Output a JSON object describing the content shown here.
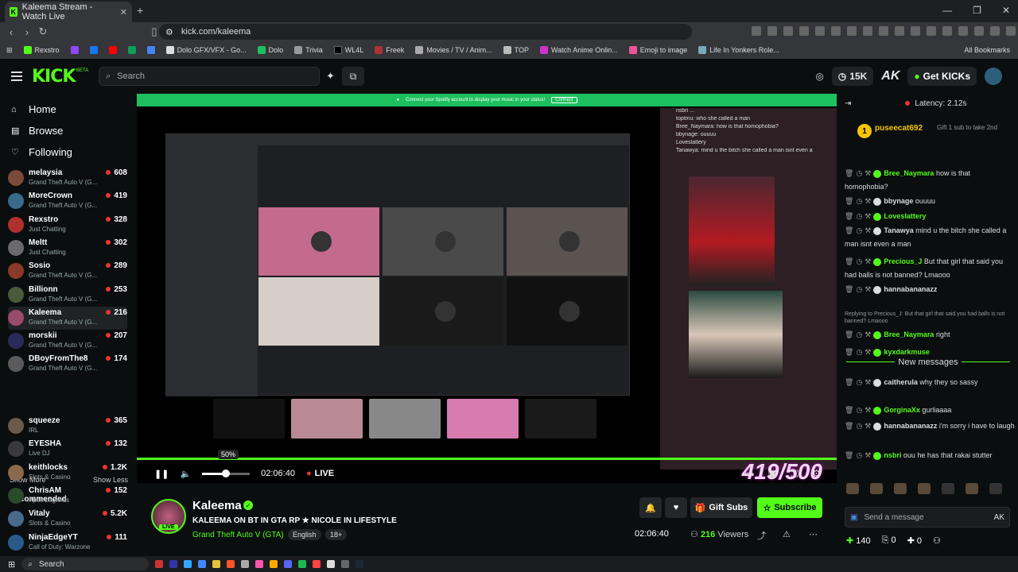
{
  "browser": {
    "tab_title": "Kaleema Stream - Watch Live",
    "url": "kick.com/kaleema",
    "bookmarks": [
      "Rexstro",
      "Dolo GFX/VFX - Go...",
      "Dolo",
      "Trivia",
      "WL4L",
      "Freek",
      "Movies / TV / Anim...",
      "TOP",
      "Watch Anime Onlin...",
      "Emoji to image",
      "Life In Yonkers Role..."
    ],
    "all_bookmarks": "All Bookmarks"
  },
  "header": {
    "logo": "KICK",
    "beta": "BETA",
    "search_placeholder": "Search",
    "kicks": "15K",
    "ak": "AK",
    "get_kicks": "Get KICKs"
  },
  "sidebar": {
    "nav": [
      {
        "label": "Home",
        "icon": "home-icon"
      },
      {
        "label": "Browse",
        "icon": "browse-icon"
      },
      {
        "label": "Following",
        "icon": "heart-icon"
      }
    ],
    "following": [
      {
        "name": "melaysia",
        "game": "Grand Theft Auto V (G...",
        "viewers": "608",
        "color": "#7a4a3a"
      },
      {
        "name": "MoreCrown",
        "game": "Grand Theft Auto V (G...",
        "viewers": "419",
        "color": "#3a6a8a"
      },
      {
        "name": "Rexstro",
        "game": "Just Chatting",
        "viewers": "328",
        "color": "#b03030"
      },
      {
        "name": "Meltt",
        "game": "Just Chatting",
        "viewers": "302",
        "color": "#6a6a6a"
      },
      {
        "name": "Sosio",
        "game": "Grand Theft Auto V (G...",
        "viewers": "289",
        "color": "#8a3a2a"
      },
      {
        "name": "Billionn",
        "game": "Grand Theft Auto V (G...",
        "viewers": "253",
        "color": "#4a5a3a"
      },
      {
        "name": "Kaleema",
        "game": "Grand Theft Auto V (G...",
        "viewers": "216",
        "color": "#9a4a6a"
      },
      {
        "name": "morskii",
        "game": "Grand Theft Auto V (G...",
        "viewers": "207",
        "color": "#2a2a5a"
      },
      {
        "name": "DBoyFromThe8",
        "game": "Grand Theft Auto V (G...",
        "viewers": "174",
        "color": "#5a5a5a"
      }
    ],
    "show_more": "Show More",
    "show_less": "Show Less",
    "recommended_title": "Recommended",
    "recommended": [
      {
        "name": "squeeze",
        "game": "IRL",
        "viewers": "365",
        "color": "#6a5a4a"
      },
      {
        "name": "EYESHA",
        "game": "Live DJ",
        "viewers": "132",
        "color": "#3a3a3a"
      },
      {
        "name": "keithlocks",
        "game": "Slots & Casino",
        "viewers": "1.2K",
        "color": "#8a6a4a"
      },
      {
        "name": "ChrisAM",
        "game": "Apex Legends",
        "viewers": "152",
        "color": "#2a4a2a"
      },
      {
        "name": "Vitaly",
        "game": "Slots & Casino",
        "viewers": "5.2K",
        "color": "#4a6a8a"
      },
      {
        "name": "NinjaEdgeYT",
        "game": "Call of Duty: Warzone",
        "viewers": "111",
        "color": "#2a5a8a"
      }
    ]
  },
  "video": {
    "spotify_banner": "Connect your Spotify account to display your music in your status!",
    "spotify_button": "Connect",
    "overlay_count": "419/500",
    "volume_tooltip": "50%",
    "volume": 0.5,
    "time": "02:06:40",
    "live": "LIVE"
  },
  "stream": {
    "name": "Kaleema",
    "title": "KALEEMA ON BT IN GTA RP ★ NICOLE IN LIFESTYLE",
    "game": "Grand Theft Auto V (GTA)",
    "tags": [
      "English",
      "18+"
    ],
    "live_badge": "LIVE",
    "gift_subs": "Gift Subs",
    "subscribe": "Subscribe",
    "uptime": "02:06:40",
    "viewers": "216",
    "viewers_label": "Viewers"
  },
  "chat": {
    "latency": "Latency: 2.12s",
    "pinned_user": "puseecat692",
    "pinned_rank": "1",
    "pinned_text": "Gift 1 sub to take 2nd",
    "messages": [
      {
        "user": "Bree_Naymara",
        "color": "#53fc18",
        "text": "how is that homophobia?"
      },
      {
        "user": "bbynage",
        "color": "#ddd",
        "text": "ouuuu"
      },
      {
        "user": "Loveslattery",
        "color": "#53fc18",
        "text": ""
      },
      {
        "user": "Tanawya",
        "color": "#ddd",
        "text": "mind u the bitch she called a man isnt even a man"
      },
      {
        "user": "Precious_J",
        "color": "#53fc18",
        "text": "But that girl that said you had balls is not banned? Lmaooo"
      },
      {
        "user": "hannabananazz",
        "color": "#ddd",
        "text": ""
      }
    ],
    "reply_text": "Replying to Precious_J: But that girl that said you had balls is not banned? Lmaooo",
    "messages2": [
      {
        "user": "Bree_Naymara",
        "color": "#53fc18",
        "text": "right"
      },
      {
        "user": "kyxdarkmuse",
        "color": "#53fc18",
        "text": ""
      }
    ],
    "new_messages": "New messages",
    "messages3": [
      {
        "user": "caitherula",
        "color": "#ddd",
        "text": "why they so sassy"
      },
      {
        "user": "GorginaXx",
        "color": "#53fc18",
        "text": "gurliaaaa"
      },
      {
        "user": "hannabananazz",
        "color": "#ddd",
        "text": "i'm sorry i have to laugh"
      },
      {
        "user": "nsbri",
        "color": "#53fc18",
        "text": "ouu he has that rakai stutter"
      }
    ],
    "input_placeholder": "Send a message",
    "points": "140",
    "stat1": "0",
    "stat2": "0"
  },
  "taskbar": {
    "search": "Search"
  }
}
